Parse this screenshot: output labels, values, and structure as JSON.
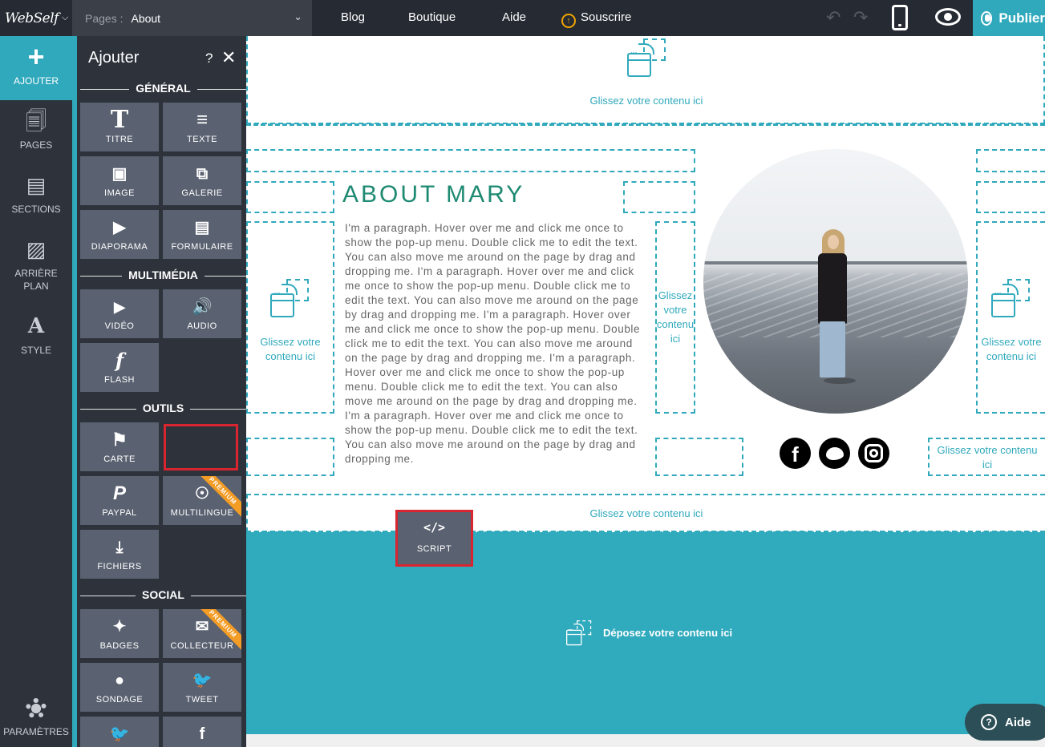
{
  "topbar": {
    "logo": "WebSelf",
    "pages_label": "Pages :",
    "current_page": "About",
    "nav": [
      "Blog",
      "Boutique",
      "Aide"
    ],
    "subscribe": "Souscrire",
    "publish": "Publier"
  },
  "leftnav": {
    "items": [
      {
        "label": "AJOUTER",
        "icon": "plus-icon"
      },
      {
        "label": "PAGES",
        "icon": "pages-icon"
      },
      {
        "label": "SECTIONS",
        "icon": "sections-icon"
      },
      {
        "label": "ARRIÈRE PLAN",
        "icon": "background-icon"
      },
      {
        "label": "STYLE",
        "icon": "style-icon"
      }
    ],
    "settings": "PARAMÈTRES"
  },
  "panel": {
    "title": "Ajouter",
    "help": "?",
    "close": "✕",
    "sections": {
      "general": "GÉNÉRAL",
      "multimedia": "MULTIMÉDIA",
      "tools": "OUTILS",
      "social": "SOCIAL"
    },
    "tiles": {
      "titre": "TITRE",
      "texte": "TEXTE",
      "image": "IMAGE",
      "galerie": "GALERIE",
      "diaporama": "DIAPORAMA",
      "formulaire": "FORMULAIRE",
      "video": "VIDÉO",
      "audio": "AUDIO",
      "flash": "FLASH",
      "carte": "CARTE",
      "paypal": "PAYPAL",
      "multilingue": "MULTILINGUE",
      "fichiers": "FICHIERS",
      "badges": "BADGES",
      "collecteur": "COLLECTEUR",
      "sondage": "SONDAGE",
      "tweet": "TWEET"
    },
    "premium": "PREMIUM"
  },
  "canvas": {
    "drop_text": "Glissez votre contenu ici",
    "drop_text_wrapped_a": "Glissez votre\ncontenu ici",
    "drop_text_wrapped_b": "Glissez\nvotre\ncontenu\nici",
    "drop_text_wrapped_c": "Glissez votre contenu\nici",
    "about_title": "ABOUT MARY",
    "about_paragraph": "I'm a paragraph. Hover over me and click me once to show the pop-up menu. Double click me to edit the text. You can also move me around on the page by drag and dropping me.  I'm a paragraph. Hover over me and click me once to show the pop-up menu. Double click me to edit the text. You can also move me around on the page by drag and dropping me.  I'm a paragraph. Hover over me and click me once to show the pop-up menu. Double click me to edit the text. You can also move me around on the page by drag and dropping me.  I'm a paragraph. Hover over me and click me once to show the pop-up menu. Double click me to edit the text. You can also move me around on the page by drag and dropping me.  I'm a paragraph. Hover over me and click me once to show the pop-up menu. Double click me to edit the text. You can also move me around on the page by drag and dropping me.",
    "deposit_text": "Déposez votre contenu ici",
    "social_fb": "f"
  },
  "dragging": {
    "icon": "</>",
    "label": "SCRIPT"
  },
  "help_button": "Aide",
  "colors": {
    "accent": "#30a9bc",
    "dark": "#2d323b",
    "tile": "#5a6170",
    "highlight": "#d9252f",
    "premium": "#f39c26",
    "title_green": "#1e8a72"
  }
}
